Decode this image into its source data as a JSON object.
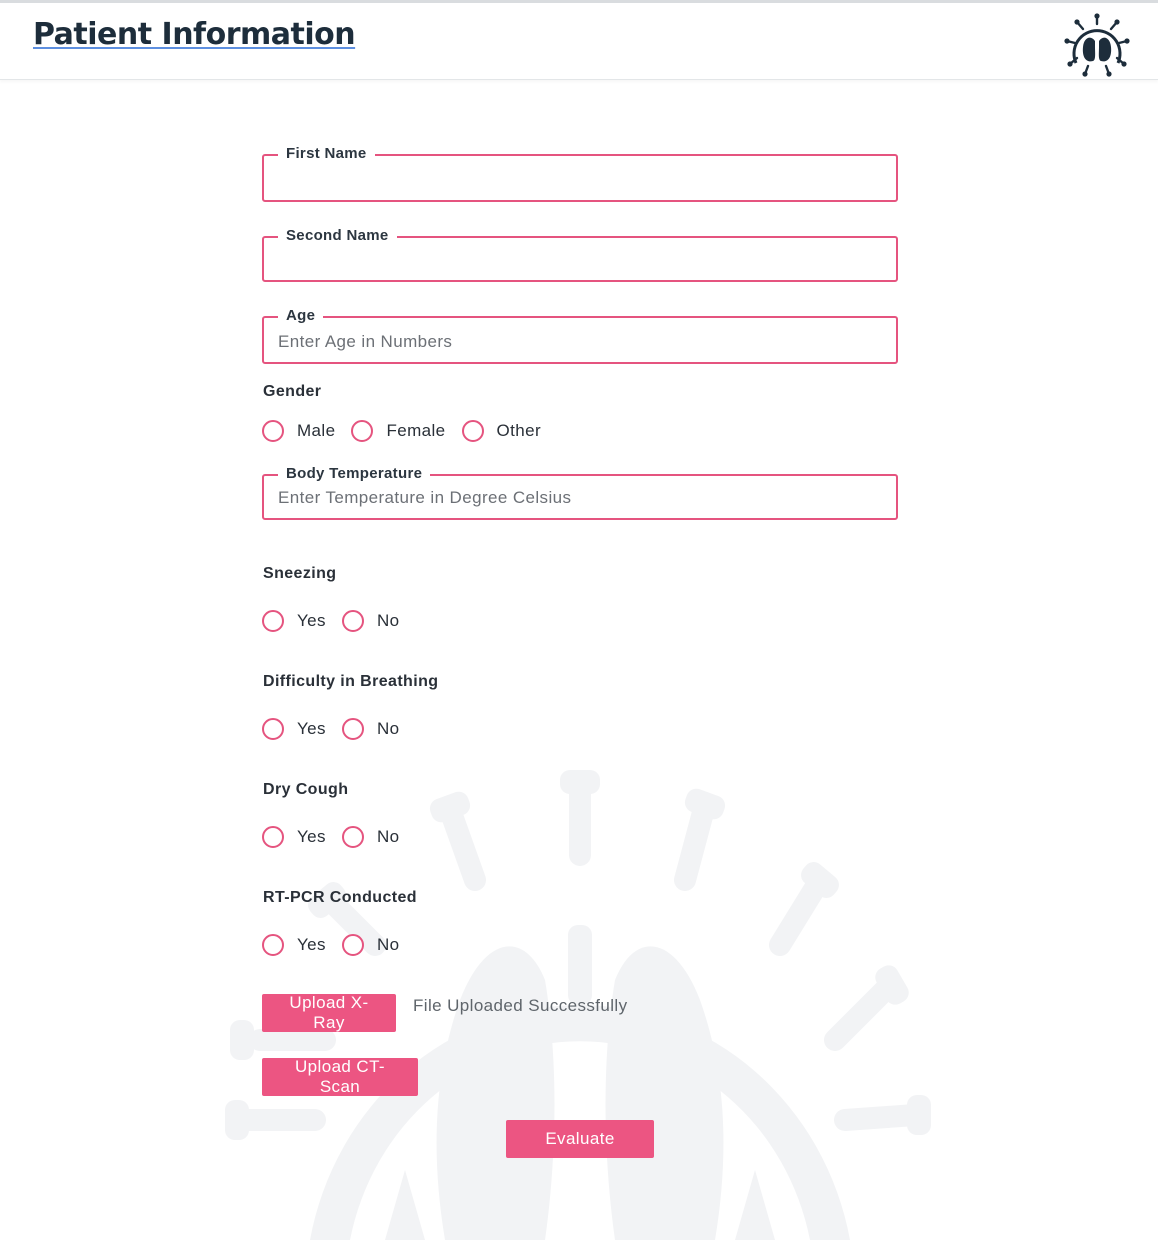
{
  "header": {
    "title": "Patient Information",
    "logo_icon": "virus-lungs-logo-icon"
  },
  "form": {
    "first_name": {
      "label": "First Name",
      "value": "",
      "placeholder": ""
    },
    "second_name": {
      "label": "Second Name",
      "value": "",
      "placeholder": ""
    },
    "age": {
      "label": "Age",
      "value": "",
      "placeholder": "Enter Age in Numbers"
    },
    "gender": {
      "label": "Gender",
      "options": [
        "Male",
        "Female",
        "Other"
      ]
    },
    "body_temperature": {
      "label": "Body Temperature",
      "value": "",
      "placeholder": "Enter Temperature in Degree Celsius"
    },
    "sneezing": {
      "label": "Sneezing",
      "options": [
        "Yes",
        "No"
      ]
    },
    "breathing": {
      "label": "Difficulty in Breathing",
      "options": [
        "Yes",
        "No"
      ]
    },
    "dry_cough": {
      "label": "Dry Cough",
      "options": [
        "Yes",
        "No"
      ]
    },
    "rtpcr": {
      "label": "RT-PCR Conducted",
      "options": [
        "Yes",
        "No"
      ]
    }
  },
  "uploads": {
    "xray_label": "Upload X-Ray",
    "xray_status": "File Uploaded Successfully",
    "ct_label": "Upload CT-Scan"
  },
  "actions": {
    "evaluate_label": "Evaluate"
  },
  "colors": {
    "accent": "#ec5582",
    "field_border": "#e5547f",
    "title": "#1d2d3b",
    "watermark": "#f2f3f5"
  }
}
